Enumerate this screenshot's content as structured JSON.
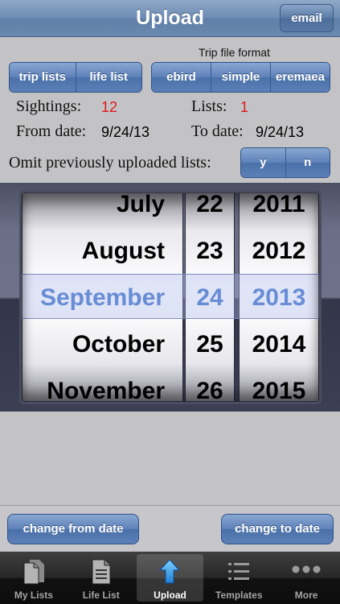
{
  "navbar": {
    "title": "Upload",
    "email_label": "email"
  },
  "list_type": {
    "options": [
      "trip lists",
      "life list"
    ]
  },
  "trip_format": {
    "label": "Trip file format",
    "options": [
      "ebird",
      "simple",
      "eremaea"
    ]
  },
  "stats": {
    "sightings_label": "Sightings:",
    "sightings_value": "12",
    "lists_label": "Lists:",
    "lists_value": "1",
    "from_label": "From date:",
    "from_value": "9/24/13",
    "to_label": "To date:",
    "to_value": "9/24/13"
  },
  "omit": {
    "label": "Omit previously uploaded lists:",
    "options": [
      "y",
      "n"
    ]
  },
  "picker": {
    "months": [
      "July",
      "August",
      "September",
      "October",
      "November"
    ],
    "days": [
      "22",
      "23",
      "24",
      "25",
      "26"
    ],
    "years": [
      "2011",
      "2012",
      "2013",
      "2014",
      "2015"
    ],
    "selected_index": 2
  },
  "actions": {
    "change_from": "change from date",
    "change_to": "change to date"
  },
  "tabs": [
    {
      "label": "My Lists",
      "icon": "document-icon"
    },
    {
      "label": "Life List",
      "icon": "list-document-icon"
    },
    {
      "label": "Upload",
      "icon": "upload-arrow-icon"
    },
    {
      "label": "Templates",
      "icon": "bulleted-list-icon"
    },
    {
      "label": "More",
      "icon": "more-dots-icon"
    }
  ],
  "colors": {
    "accent": "#5d81b8",
    "count_red": "#e0161b",
    "selected_text": "#3f72c8"
  }
}
